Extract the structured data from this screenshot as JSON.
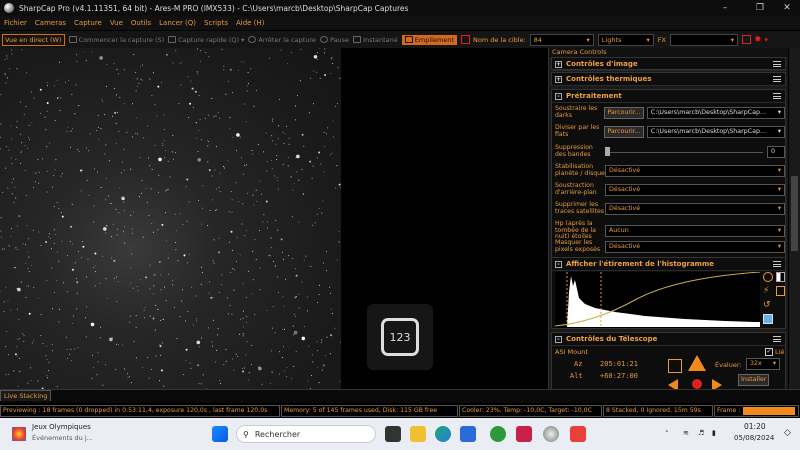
{
  "titlebar": {
    "title": "SharpCap Pro (v4.1.11351, 64 bit) - Ares-M PRO (IMX533) - C:\\Users\\marcb\\Desktop\\SharpCap Captures"
  },
  "menu": [
    "Fichier",
    "Cameras",
    "Capture",
    "Vue",
    "Outils",
    "Lancer (Q)",
    "Scripts",
    "Aide (H)"
  ],
  "toolbar": {
    "live": "Vue en direct (W)",
    "start_capture": "Commencer la capture (S)",
    "quick_capture": "Capture rapide (Q)",
    "stop_capture": "Arrêter la capture",
    "pause": "Pause",
    "snapshot": "Instantané",
    "stacking": "Empilement",
    "target_label": "Nom de la cible:",
    "target_value": "84",
    "frame_type": "Lights",
    "fx": "FX"
  },
  "logo_text": "123",
  "panel": {
    "title": "Camera Controls",
    "sections": {
      "image": "Contrôles d'image",
      "thermal": "Contrôles thermiques",
      "preprocess": "Prétraitement",
      "histogram": "Afficher l'étirement de l'histogramme",
      "telescope": "Contrôles du Télescope"
    },
    "preprocess_rows": {
      "darks_label": "Soustraire les darks",
      "flats_label": "Diviser par les flats",
      "browse": "Parcourir...",
      "darks_path": "C:\\Users\\marcb\\Desktop\\SharpCap...",
      "flats_path": "C:\\Users\\marcb\\Desktop\\SharpCap...",
      "banding_label": "Suppression des bandes",
      "banding_value": "0",
      "stab_label": "Stabilisation planète / disque",
      "stab_value": "Désactivé",
      "bg_label": "Soustraction d'arrière-plan",
      "bg_value": "Désactivé",
      "sat_label": "Supprimer les traces satellites",
      "sat_value": "Désactivé",
      "hp_label": "Hp (après la tombée de la nuit) étoiles",
      "hp_value": "Aucun",
      "hot_label": "Masquer les pixels exposés",
      "hot_value": "Désactivé"
    },
    "telescope": {
      "mount": "ASI Mount",
      "az_label": "Az",
      "az_value": "205:01:21",
      "alt_label": "Alt",
      "alt_value": "+60:27:00",
      "eval_label": "Évaluer:",
      "eval_value": "32x",
      "lie_label": "Lié",
      "install": "Installer"
    }
  },
  "livestack_tab": "Live Stacking",
  "status": {
    "preview": "Previewing : 18 frames (0 dropped) in 0:53:11,4, exposure 120,0s , last frame 120,0s",
    "memory": "Memory: 5 of 145 frames used, Disk: 115 GB free",
    "cooler": "Cooler: 23%, Temp: -10,0C, Target: -10,0C",
    "stacked": "8 Stacked, 0 Ignored, 15m 59s",
    "frame": "Frame :"
  },
  "taskbar": {
    "weather_title": "Jeux Olympiques",
    "weather_sub": "Événements du j...",
    "search": "Rechercher",
    "time": "01:20",
    "date": "05/08/2024"
  }
}
